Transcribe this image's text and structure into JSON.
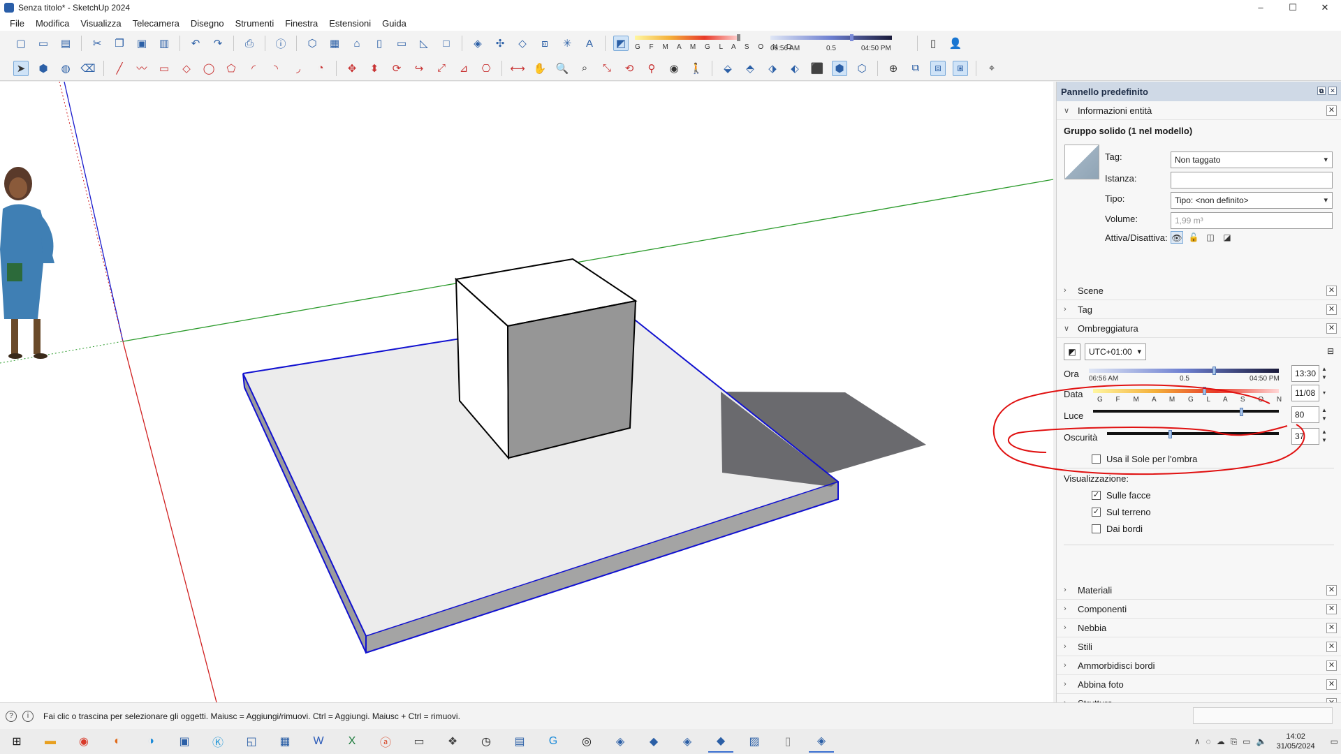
{
  "window": {
    "title": "Senza titolo* - SketchUp 2024",
    "controls": [
      "–",
      "☐",
      "✕"
    ]
  },
  "menu": [
    "File",
    "Modifica",
    "Visualizza",
    "Telecamera",
    "Disegno",
    "Strumenti",
    "Finestra",
    "Estensioni",
    "Guida"
  ],
  "shadow_toolbar": {
    "months": "G F M A M G L A S O N D",
    "time_start": "06:56 AM",
    "time_mid": "0.5",
    "time_end": "04:50 PM"
  },
  "tray": {
    "title": "Pannello predefinito",
    "entity_info": {
      "header": "Informazioni entità",
      "group_title": "Gruppo solido (1 nel modello)",
      "tag_label": "Tag:",
      "tag_value": "Non taggato",
      "instance_label": "Istanza:",
      "instance_value": "",
      "type_label": "Tipo:",
      "type_value": "Tipo: <non definito>",
      "volume_label": "Volume:",
      "volume_value": "1,99 m³",
      "toggle_label": "Attiva/Disattiva:"
    },
    "sections_before": [
      "Scene",
      "Tag"
    ],
    "shadows": {
      "header": "Ombreggiatura",
      "timezone": "UTC+01:00",
      "time_label": "Ora",
      "time_start": "06:56 AM",
      "time_mid": "0.5",
      "time_end": "04:50 PM",
      "time_value": "13:30",
      "date_label": "Data",
      "months": "G F M A M G L A S O N D",
      "date_value": "11/08",
      "light_label": "Luce",
      "light_value": "80",
      "dark_label": "Oscurità",
      "dark_value": "37",
      "sun_for_shading": "Usa il Sole per l'ombra",
      "display_label": "Visualizzazione:",
      "on_faces": "Sulle facce",
      "on_ground": "Sul terreno",
      "from_edges": "Dai bordi"
    },
    "sections_after": [
      "Materiali",
      "Componenti",
      "Nebbia",
      "Stili",
      "Ammorbidisci bordi",
      "Abbina foto",
      "Struttura"
    ]
  },
  "shadow_levels": {
    "time_fraction": 0.66,
    "date_fraction": 0.6,
    "light": 80,
    "dark": 37
  },
  "status": {
    "message": "Fai clic o trascina per selezionare gli oggetti. Maiusc = Aggiungi/rimuovi. Ctrl = Aggiungi. Maiusc + Ctrl = rimuovi."
  },
  "taskbar": {
    "time": "14:02",
    "date": "31/05/2024"
  },
  "colors": {
    "x_axis": "#d02020",
    "y_axis": "#2a9a2a",
    "z_axis": "#1a1acc",
    "selection": "#1010d0",
    "annotation": "#e01010",
    "tray_header": "#cfd9e6"
  }
}
